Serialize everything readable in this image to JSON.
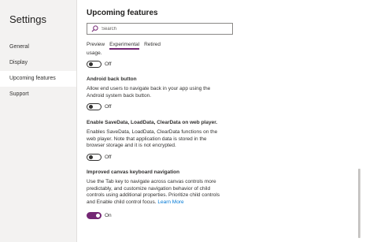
{
  "sidebar": {
    "title": "Settings",
    "items": [
      {
        "label": "General"
      },
      {
        "label": "Display"
      },
      {
        "label": "Upcoming features"
      },
      {
        "label": "Support"
      }
    ]
  },
  "main": {
    "title": "Upcoming features",
    "search": {
      "placeholder": "Search",
      "value": ""
    },
    "tabs": [
      {
        "label": "Preview"
      },
      {
        "label": "Experimental"
      },
      {
        "label": "Retired"
      }
    ],
    "active_tab": "Experimental",
    "cut_text": "usage.",
    "features": [
      {
        "state_label": "Off"
      },
      {
        "title": "Android back button",
        "description": "Allow end users to navigate back in your app using the Android system back button.",
        "state_label": "Off"
      },
      {
        "title": "Enable SaveData, LoadData, ClearData on web player.",
        "description": "Enables SaveData, LoadData, ClearData functions on the web player. Note that application data is stored in the browser storage and it is not encrypted.",
        "state_label": "Off"
      },
      {
        "title": "Improved canvas keyboard navigation",
        "description": "Use the Tab key to navigate across canvas controls more predictably, and customize navigation behavior of child controls using additional properties. Prioritize child controls and Enable child control focus.",
        "link": "Learn More",
        "state_label": "On"
      }
    ]
  },
  "colors": {
    "accent": "#742774",
    "link": "#0078d4",
    "sidebar_bg": "#f3f2f1",
    "panel_bg": "#ffffff"
  }
}
